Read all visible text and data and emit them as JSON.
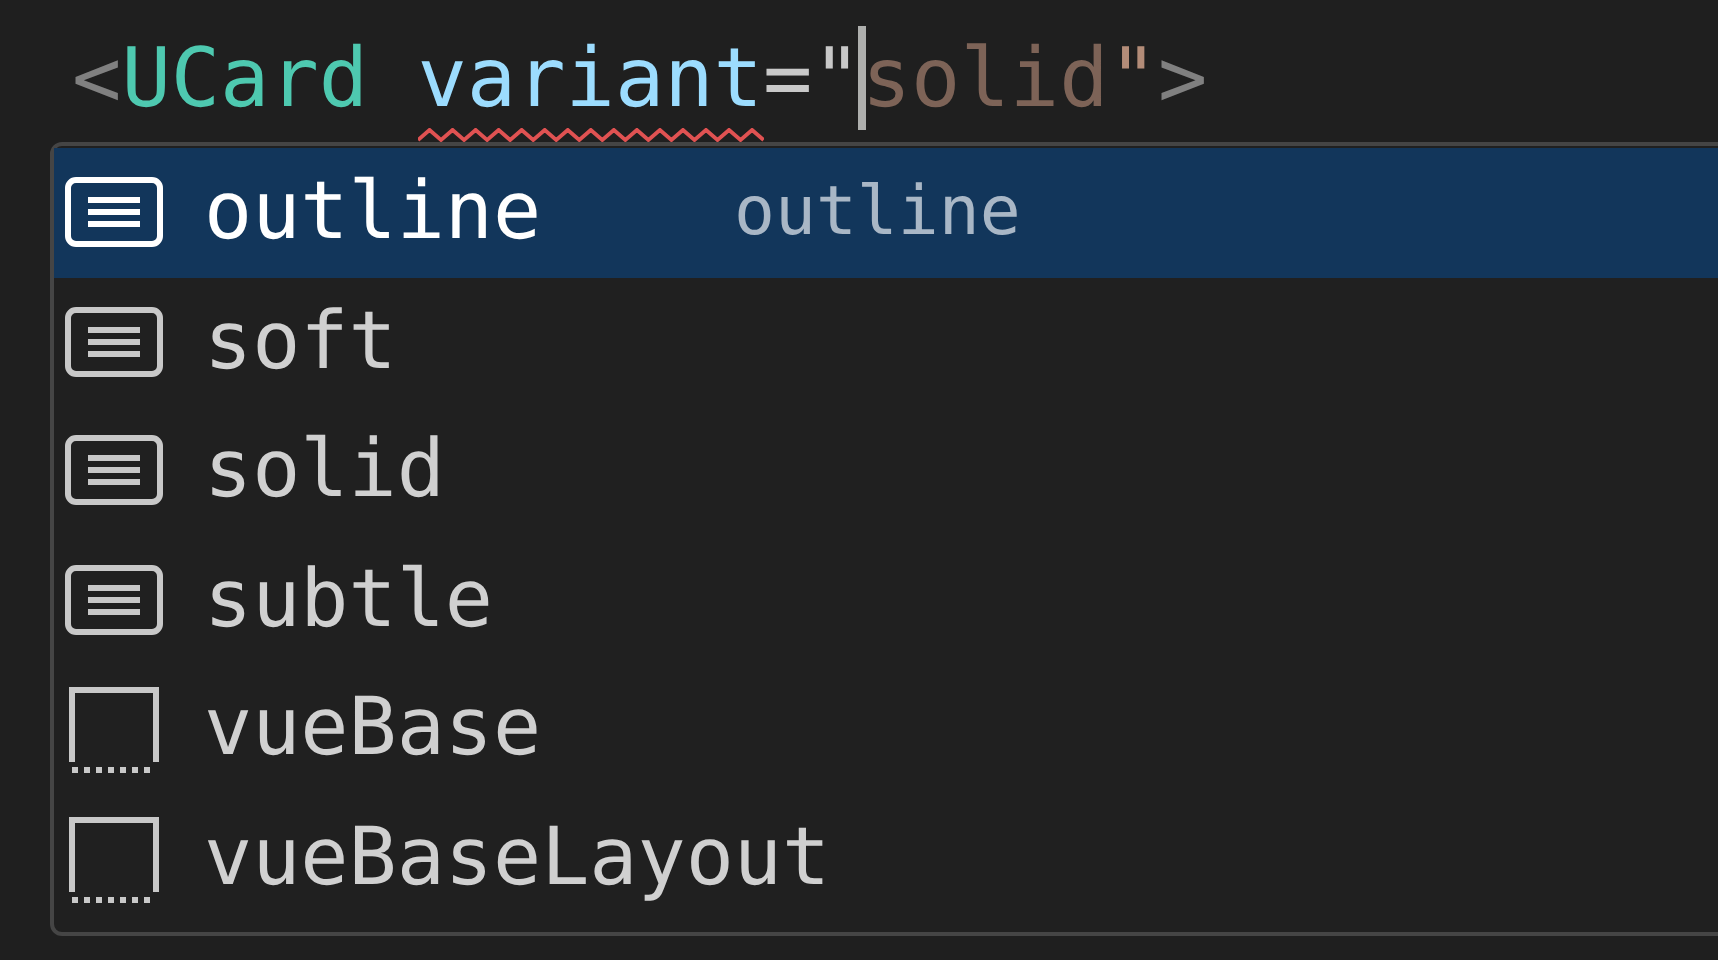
{
  "editor": {
    "tokens": [
      {
        "kind": "punct",
        "text": "<"
      },
      {
        "kind": "tag",
        "text": "UCard"
      },
      {
        "kind": "attr",
        "text": "variant",
        "error": true
      },
      {
        "kind": "punct2",
        "text": "=\""
      },
      {
        "kind": "ghost",
        "text": "solid",
        "cursor_before": true
      },
      {
        "kind": "quote",
        "text": "\""
      },
      {
        "kind": "punct",
        "text": ">"
      }
    ]
  },
  "suggestions": [
    {
      "kind": "enum",
      "label": "outline",
      "detail": "outline",
      "selected": true
    },
    {
      "kind": "enum",
      "label": "soft",
      "selected": false
    },
    {
      "kind": "enum",
      "label": "solid",
      "selected": false
    },
    {
      "kind": "enum",
      "label": "subtle",
      "selected": false
    },
    {
      "kind": "file",
      "label": "vueBase",
      "selected": false
    },
    {
      "kind": "file",
      "label": "vueBaseLayout",
      "selected": false
    }
  ]
}
